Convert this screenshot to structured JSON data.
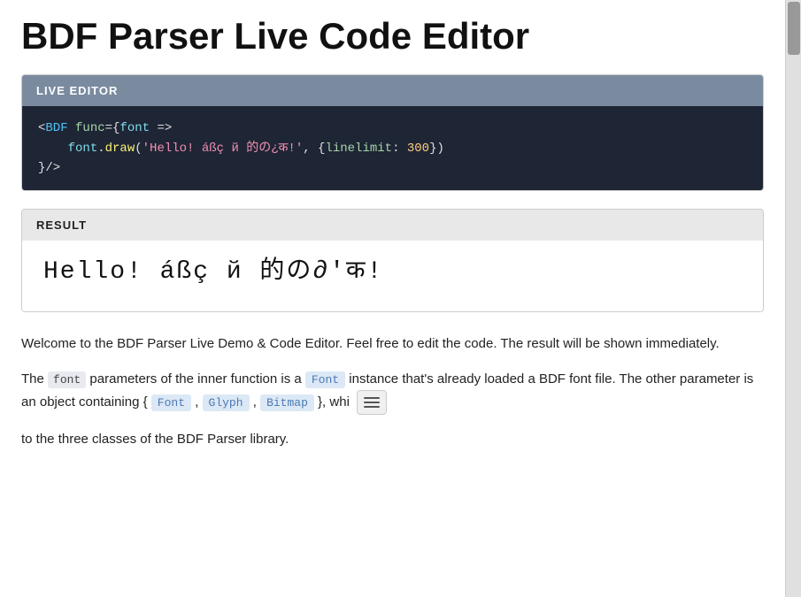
{
  "page": {
    "title": "BDF Parser Live Code Editor"
  },
  "live_editor": {
    "header_label": "LIVE EDITOR",
    "code_lines": [
      {
        "id": "line1",
        "raw": "<BDF func={font =>"
      },
      {
        "id": "line2",
        "raw": "    font.draw('Hello! áßç й 的の¿क!', {linelimit: 300})"
      },
      {
        "id": "line3",
        "raw": "/>"
      }
    ]
  },
  "result": {
    "header_label": "RESULT",
    "rendered_text": "Hello! áßç й 的の∂'क!"
  },
  "description": {
    "para1": "Welcome to the BDF Parser Live Demo & Code Editor. Feel free to edit the code. The result will be shown immediately.",
    "para2_prefix": "The",
    "para2_font_code": "font",
    "para2_middle": "parameters of the inner function is a",
    "para2_Font_code": "Font",
    "para2_suffix": "instance that's already loaded a BDF font file. The other parameter is an object containing {",
    "para2_Font2_code": "Font",
    "para2_comma1": ",",
    "para2_Glyph_code": "Glyph",
    "para2_comma2": ",",
    "para2_Bitmap_code": "Bitmap",
    "para2_end": "}, whi",
    "para3": "to the three classes of the BDF Parser library."
  }
}
